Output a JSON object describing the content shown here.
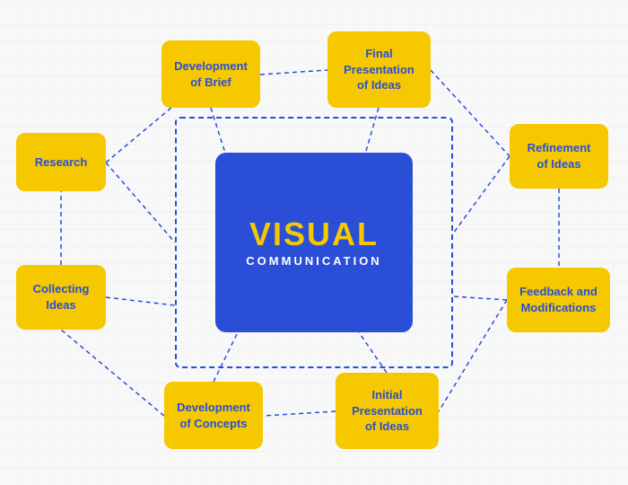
{
  "diagram": {
    "title": "VISUAL",
    "subtitle": "COMMUNICATION",
    "nodes": {
      "dev_brief": {
        "line1": "Development",
        "line2": "of Brief"
      },
      "final_pres": {
        "line1": "Final",
        "line2": "Presentation",
        "line3": "of Ideas"
      },
      "refinement": {
        "line1": "Refinement",
        "line2": "of Ideas"
      },
      "feedback": {
        "line1": "Feedback and",
        "line2": "Modifications"
      },
      "initial_pres": {
        "line1": "Initial",
        "line2": "Presentation",
        "line3": "of Ideas"
      },
      "dev_concepts": {
        "line1": "Development",
        "line2": "of Concepts"
      },
      "collecting": {
        "line1": "Collecting",
        "line2": "Ideas"
      },
      "research": {
        "line1": "Research"
      }
    },
    "colors": {
      "yellow": "#f5c800",
      "blue": "#2a4fd6",
      "white": "#ffffff"
    }
  }
}
